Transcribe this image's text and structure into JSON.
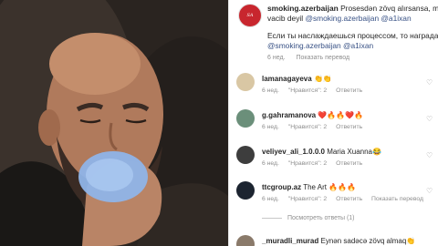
{
  "post": {
    "username": "smoking.azerbaijan",
    "caption_line1": "Prosesdən zövq alırsansa, mükafat",
    "caption_line2_text": "vacib deyil",
    "caption_line2_mentions": "@smoking.azerbaijan @a1ixan",
    "caption_line3": "Если ты наслаждаешься процессом, то награда не важна",
    "caption_line4_mentions": "@smoking.azerbaijan @a1ixan",
    "time": "6 нед.",
    "translate": "Показать перевод"
  },
  "comments": [
    {
      "username": "lamanagayeva",
      "text": "👏👏",
      "time": "6 нед.",
      "likes": "\"Нравится\": 2",
      "reply": "Ответить",
      "avatar_color": "#d9c7a4"
    },
    {
      "username": "g.gahramanova",
      "text": "❤️🔥🔥❤️🔥",
      "time": "6 нед.",
      "likes": "\"Нравится\": 2",
      "reply": "Ответить",
      "avatar_color": "#6b8f7a"
    },
    {
      "username": "veliyev_ali_1.0.0.0",
      "text": "Maria Xuanna😂",
      "time": "6 нед.",
      "likes": "\"Нравится\": 2",
      "reply": "Ответить",
      "avatar_color": "#3d3d3d"
    },
    {
      "username": "ttcgroup.az",
      "text": "The Art 🔥🔥🔥",
      "time": "6 нед.",
      "likes": "\"Нравится\": 2",
      "reply": "Ответить",
      "translate": "Показать перевод",
      "avatar_color": "#1c2430"
    },
    {
      "username": "_muradli_murad",
      "text": "Eynən sadəcə zövq almaq👏",
      "avatar_color": "#8a7a6a"
    }
  ],
  "replies_link": "Посмотреть ответы (1)"
}
